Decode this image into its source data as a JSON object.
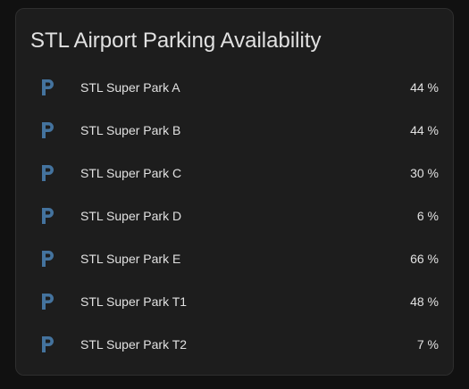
{
  "card": {
    "title": "STL Airport Parking Availability",
    "icon_name": "parking-icon",
    "icon_color": "#44739e"
  },
  "entities": [
    {
      "name": "STL Super Park A",
      "value": "44",
      "unit": "%",
      "display": "44 %"
    },
    {
      "name": "STL Super Park B",
      "value": "44",
      "unit": "%",
      "display": "44 %"
    },
    {
      "name": "STL Super Park C",
      "value": "30",
      "unit": "%",
      "display": "30 %"
    },
    {
      "name": "STL Super Park D",
      "value": "6",
      "unit": "%",
      "display": "6 %"
    },
    {
      "name": "STL Super Park E",
      "value": "66",
      "unit": "%",
      "display": "66 %"
    },
    {
      "name": "STL Super Park T1",
      "value": "48",
      "unit": "%",
      "display": "48 %"
    },
    {
      "name": "STL Super Park T2",
      "value": "7",
      "unit": "%",
      "display": "7 %"
    }
  ]
}
